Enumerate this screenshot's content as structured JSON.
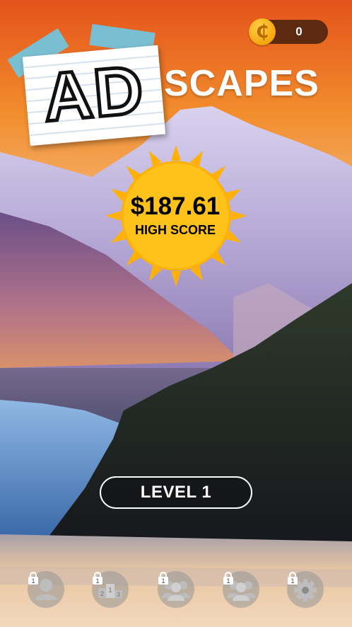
{
  "header": {
    "coin_symbol": "₵",
    "coin_count": "0"
  },
  "logo": {
    "ad_text": "AD",
    "scapes_text": "SCAPES"
  },
  "high_score": {
    "value": "$187.61",
    "label": "HIGH SCORE"
  },
  "level_button": {
    "label": "LEVEL 1"
  },
  "bottom_nav": [
    {
      "icon": "profile-icon",
      "locked": true,
      "lock_badge": "1"
    },
    {
      "icon": "leaderboard-podium-icon",
      "locked": true,
      "lock_badge": "1",
      "podium_numbers": [
        "2",
        "1",
        "3"
      ]
    },
    {
      "icon": "friends-group-icon",
      "locked": true,
      "lock_badge": "1"
    },
    {
      "icon": "community-group-icon",
      "locked": true,
      "lock_badge": "1"
    },
    {
      "icon": "settings-gear-icon",
      "locked": true,
      "lock_badge": "1"
    }
  ],
  "colors": {
    "coin_gold": "#f5a50d",
    "sun_yellow": "#ffc21a",
    "pill_brown": "#5b2a10",
    "tape_blue": "#6ec8e4"
  }
}
